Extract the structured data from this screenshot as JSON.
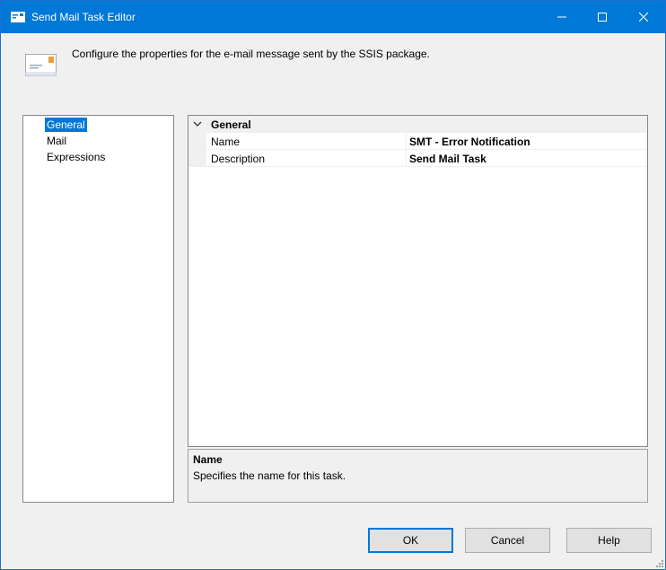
{
  "window": {
    "title": "Send Mail Task Editor",
    "icon": "mail-task-icon",
    "controls": {
      "minimize": "minimize-icon",
      "maximize": "maximize-icon",
      "close": "close-icon"
    }
  },
  "header": {
    "icon": "envelope-icon",
    "text": "Configure the properties for the e-mail message sent by the SSIS package."
  },
  "nav": {
    "items": [
      {
        "label": "General",
        "selected": true
      },
      {
        "label": "Mail",
        "selected": false
      },
      {
        "label": "Expressions",
        "selected": false
      }
    ]
  },
  "grid": {
    "category": "General",
    "properties": [
      {
        "name": "Name",
        "value": "SMT - Error Notification"
      },
      {
        "name": "Description",
        "value": "Send Mail Task"
      }
    ]
  },
  "description": {
    "title": "Name",
    "text": "Specifies the name for this task."
  },
  "buttons": {
    "ok": "OK",
    "cancel": "Cancel",
    "help": "Help"
  },
  "colors": {
    "titlebar": "#0078d7",
    "selection": "#0078d7",
    "dialog_background": "#f0f0f0"
  }
}
